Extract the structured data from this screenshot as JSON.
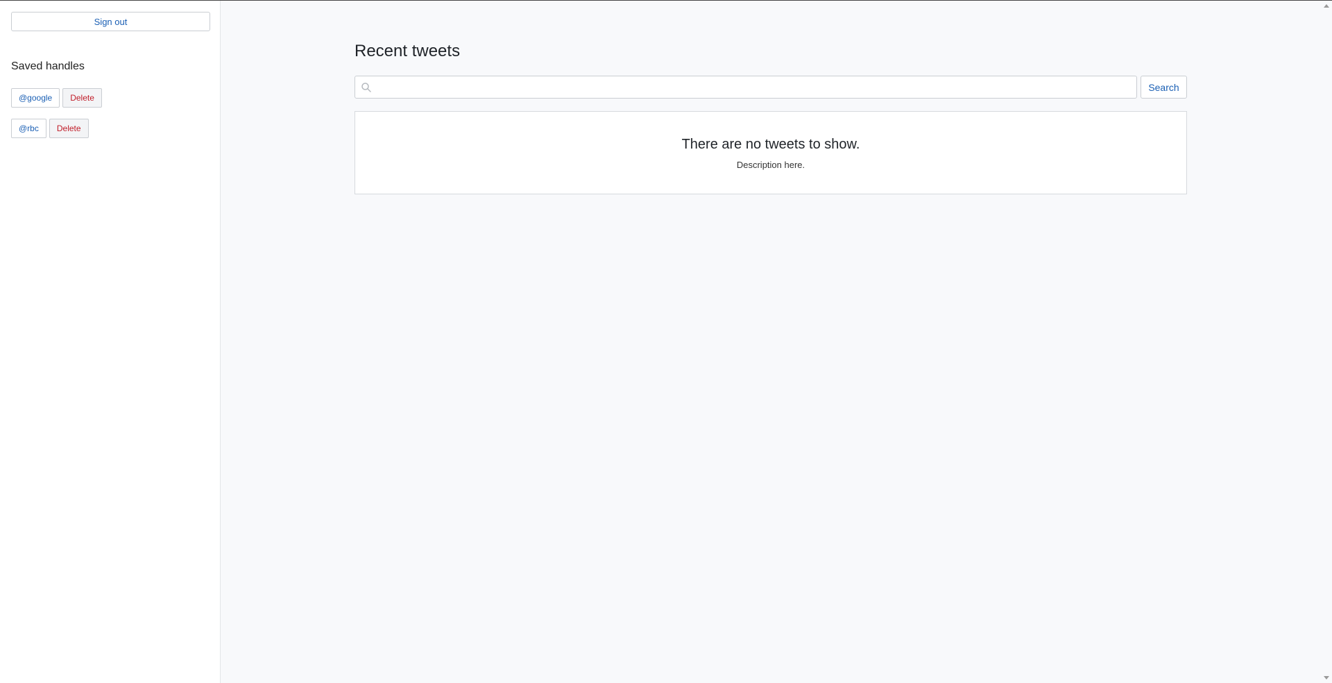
{
  "sidebar": {
    "signout_label": "Sign out",
    "saved_title": "Saved handles",
    "handles": [
      {
        "handle": "@google",
        "delete_label": "Delete"
      },
      {
        "handle": "@rbc",
        "delete_label": "Delete"
      }
    ]
  },
  "main": {
    "title": "Recent tweets",
    "search": {
      "value": "",
      "placeholder": "",
      "button_label": "Search",
      "icon": "search-icon"
    },
    "empty_state": {
      "title": "There are no tweets to show.",
      "description": "Description here."
    }
  },
  "colors": {
    "link": "#1a5fb4",
    "danger": "#c01c28",
    "page_bg": "#f8f9fb"
  }
}
